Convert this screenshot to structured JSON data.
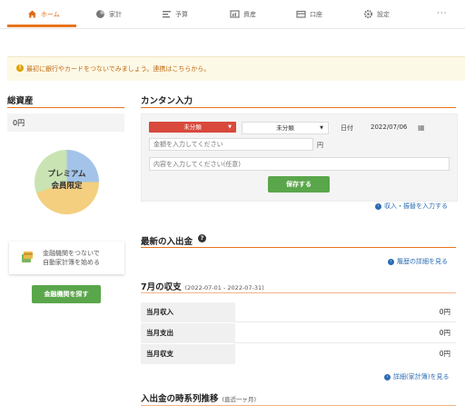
{
  "nav": {
    "tabs": [
      {
        "label": "ホーム",
        "icon": "home-icon",
        "active": true
      },
      {
        "label": "家計",
        "icon": "household-icon",
        "active": false
      },
      {
        "label": "予算",
        "icon": "budget-icon",
        "active": false
      },
      {
        "label": "資産",
        "icon": "assets-icon",
        "active": false
      },
      {
        "label": "口座",
        "icon": "accounts-icon",
        "active": false
      },
      {
        "label": "設定",
        "icon": "gear-icon",
        "active": false
      }
    ],
    "more": "···",
    "accent_color": "#e8741c"
  },
  "notice": {
    "text": "最初に銀行やカードをつないでみましょう。連携はこちらから。"
  },
  "assets": {
    "title": "総資産",
    "total": "0円",
    "premium_label_line1": "プレミアム",
    "premium_label_line2": "会員限定",
    "bank_card_line1": "金融機関をつないで",
    "bank_card_line2": "自動家計簿を始める",
    "find_bank_button": "金融機関を探す"
  },
  "quick_input": {
    "title": "カンタン入力",
    "category_main": "未分類",
    "category_sub": "未分類",
    "date_label": "日付",
    "date_value": "2022/07/06",
    "amount_placeholder": "金額を入力してください",
    "yen_unit": "円",
    "memo_placeholder": "内容を入力してください(任意)",
    "save_button": "保存する",
    "input_link": "収入・振替を入力する"
  },
  "recent": {
    "title": "最新の入出金",
    "history_link": "履歴の詳細を見る"
  },
  "monthly": {
    "title": "7月の収支",
    "range": "(2022-07-01 - 2022-07-31)",
    "rows": [
      {
        "label": "当月収入",
        "value": "0円"
      },
      {
        "label": "当月支出",
        "value": "0円"
      },
      {
        "label": "当月収支",
        "value": "0円"
      }
    ],
    "detail_link": "詳細(家計簿)を見る"
  },
  "timeseries": {
    "title": "入出金の時系列推移",
    "range": "(直近一ヶ月)"
  }
}
